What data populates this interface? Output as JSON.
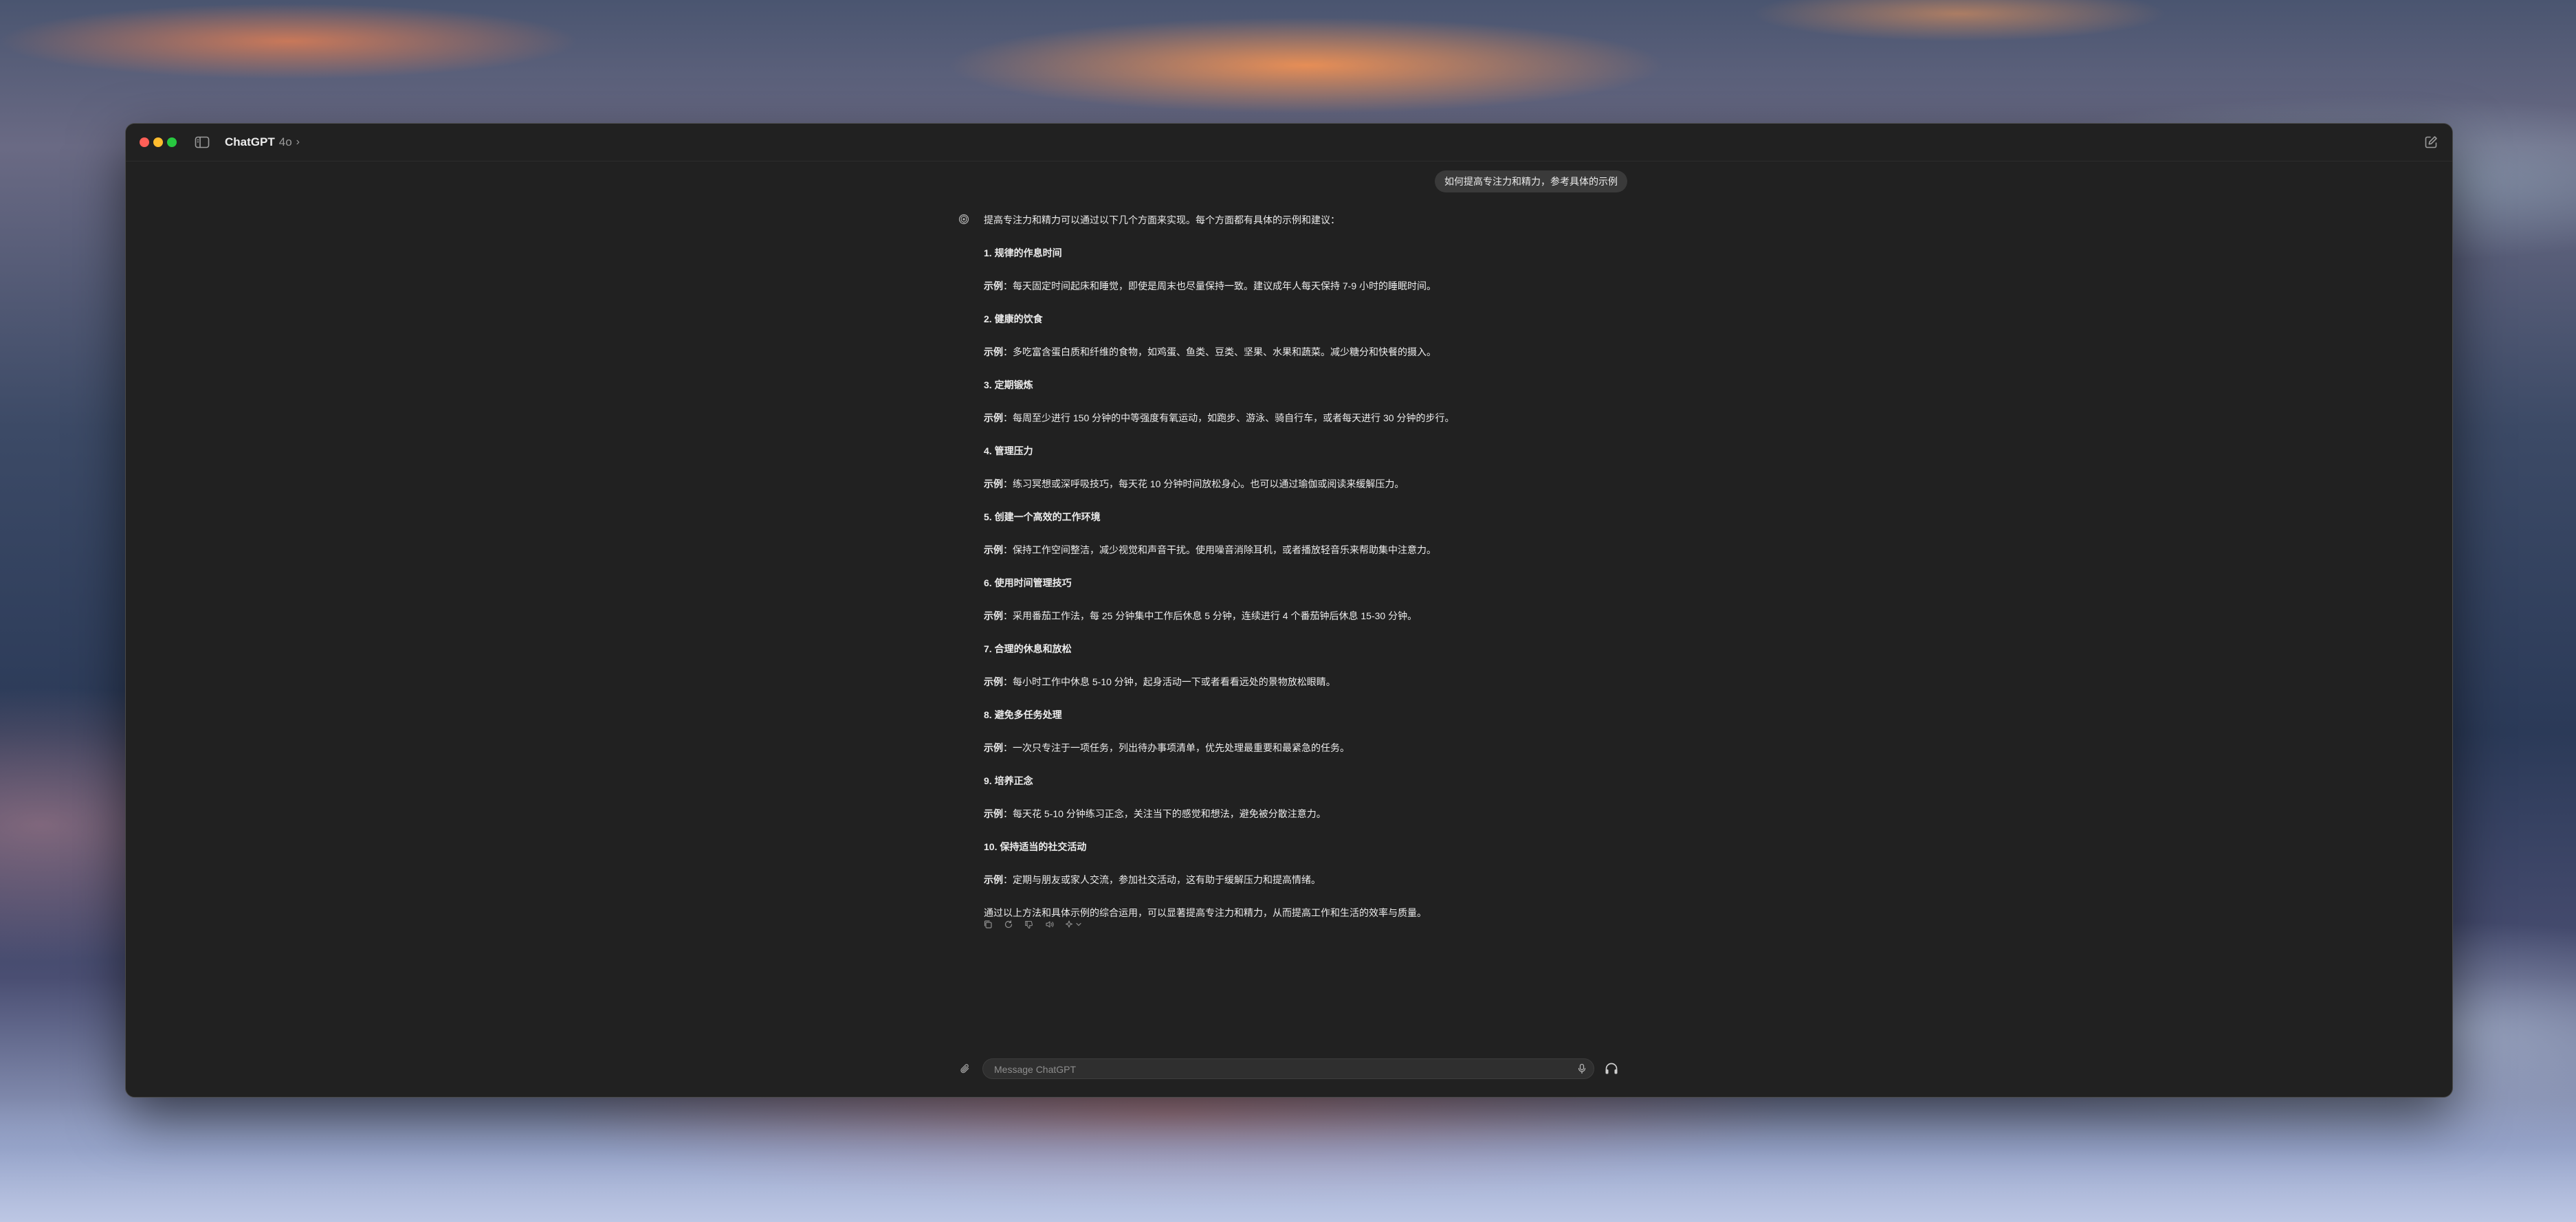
{
  "window": {
    "app_name": "ChatGPT",
    "model": "4o",
    "model_chevron": "›",
    "icons": {
      "sidebar_toggle": "sidebar-icon",
      "new_chat": "compose-icon",
      "assistant_avatar": "openai-logo-icon",
      "attach": "paperclip-icon",
      "mic": "microphone-icon",
      "voice": "headphones-icon"
    }
  },
  "conversation": {
    "user_message": "如何提高专注力和精力，参考具体的示例",
    "assistant": {
      "intro": "提高专注力和精力可以通过以下几个方面来实现。每个方面都有具体的示例和建议：",
      "example_label": "示例",
      "items": [
        {
          "heading": "1. 规律的作息时间",
          "example": "：每天固定时间起床和睡觉，即使是周末也尽量保持一致。建议成年人每天保持 7-9 小时的睡眠时间。"
        },
        {
          "heading": "2. 健康的饮食",
          "example": "：多吃富含蛋白质和纤维的食物，如鸡蛋、鱼类、豆类、坚果、水果和蔬菜。减少糖分和快餐的摄入。"
        },
        {
          "heading": "3. 定期锻炼",
          "example": "：每周至少进行 150 分钟的中等强度有氧运动，如跑步、游泳、骑自行车，或者每天进行 30 分钟的步行。"
        },
        {
          "heading": "4. 管理压力",
          "example": "：练习冥想或深呼吸技巧，每天花 10 分钟时间放松身心。也可以通过瑜伽或阅读来缓解压力。"
        },
        {
          "heading": "5. 创建一个高效的工作环境",
          "example": "：保持工作空间整洁，减少视觉和声音干扰。使用噪音消除耳机，或者播放轻音乐来帮助集中注意力。"
        },
        {
          "heading": "6. 使用时间管理技巧",
          "example": "：采用番茄工作法，每 25 分钟集中工作后休息 5 分钟，连续进行 4 个番茄钟后休息 15-30 分钟。"
        },
        {
          "heading": "7. 合理的休息和放松",
          "example": "：每小时工作中休息 5-10 分钟，起身活动一下或者看看远处的景物放松眼睛。"
        },
        {
          "heading": "8. 避免多任务处理",
          "example": "：一次只专注于一项任务，列出待办事项清单，优先处理最重要和最紧急的任务。"
        },
        {
          "heading": "9. 培养正念",
          "example": "：每天花 5-10 分钟练习正念，关注当下的感觉和想法，避免被分散注意力。"
        },
        {
          "heading": "10. 保持适当的社交活动",
          "example": "：定期与朋友或家人交流，参加社交活动，这有助于缓解压力和提高情绪。"
        }
      ],
      "conclusion": "通过以上方法和具体示例的综合运用，可以显著提高专注力和精力，从而提高工作和生活的效率与质量。",
      "actions": [
        "copy-icon",
        "regenerate-icon",
        "thumbs-down-icon",
        "read-aloud-icon",
        "model-switch-icon"
      ]
    }
  },
  "composer": {
    "placeholder": "Message ChatGPT"
  }
}
